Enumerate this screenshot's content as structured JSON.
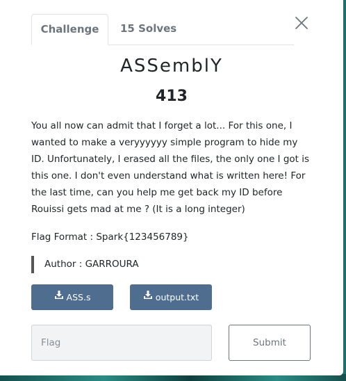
{
  "tabs": [
    {
      "label": "Challenge",
      "active": true
    },
    {
      "label": "15 Solves",
      "active": false
    }
  ],
  "challenge": {
    "name": "ASSemblY",
    "points": "413",
    "description": "You all now can admit that I forget a lot... For this one, I wanted to make a veryyyyyy simple program to hide my ID. Unfortunately, I erased all the files, the only one I got is this one. I don't even understand what is written here! For the last time, can you help me get back my ID before Rouissi gets mad at me ? (It is a long integer)",
    "flag_format": "Flag Format : Spark{123456789}",
    "author": "Author : GARROURA"
  },
  "files": [
    {
      "label": "ASS.s",
      "icon": "download-icon"
    },
    {
      "label": "output.txt",
      "icon": "download-icon"
    }
  ],
  "form": {
    "flag_placeholder": "Flag",
    "flag_value": "",
    "submit_label": "Submit"
  },
  "colors": {
    "file_button": "#4f6d8f",
    "backdrop": "#1f6f6c"
  }
}
